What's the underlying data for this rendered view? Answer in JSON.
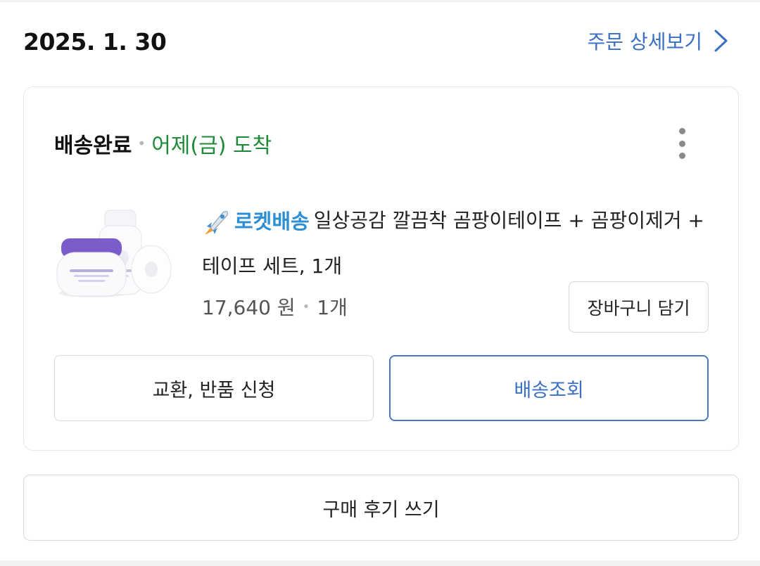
{
  "order": {
    "date": "2025. 1. 30",
    "detail_link": "주문 상세보기"
  },
  "shipment": {
    "status": "배송완료",
    "arrival": "어제(금) 도착",
    "more_icon": "more-vertical-icon"
  },
  "product": {
    "rocket_label": "로켓배송",
    "rocket_icon": "rocket-icon",
    "name": "일상공감 깔끔착 곰팡이테이프 + 곰팡이제거 + 테이프 세트, 1개",
    "price": "17,640 원",
    "quantity": "1개"
  },
  "actions": {
    "add_to_cart": "장바구니 담기",
    "exchange_return": "교환, 반품 신청",
    "track_delivery": "배송조회",
    "write_review": "구매 후기 쓰기"
  },
  "colors": {
    "link_blue": "#3a6fc4",
    "arrival_green": "#1d8a36",
    "rocket_blue": "#2c8fd6"
  }
}
